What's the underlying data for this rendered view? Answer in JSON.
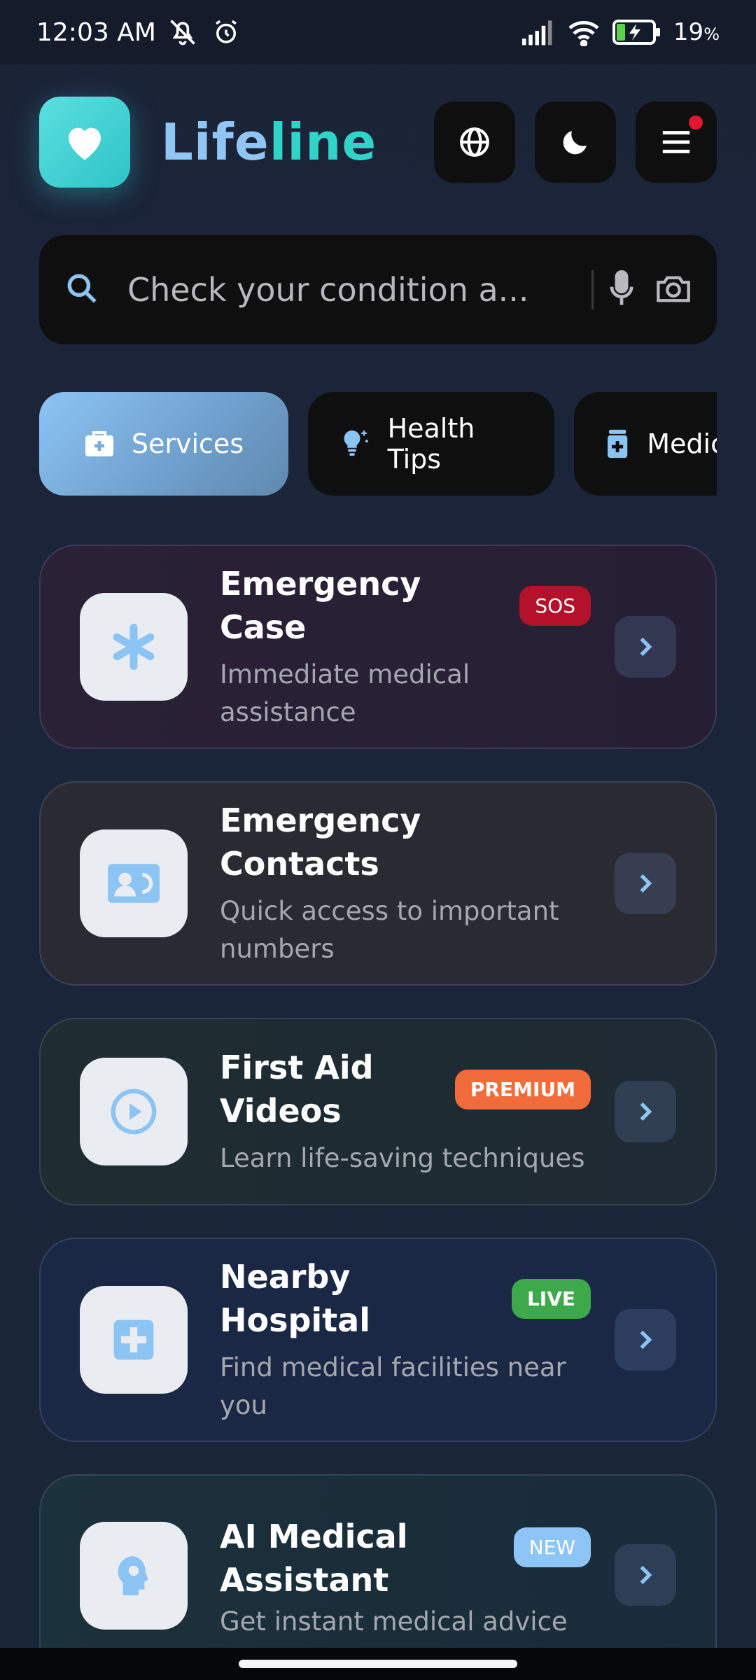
{
  "status_bar": {
    "time": "12:03 AM",
    "battery": "19",
    "battery_unit": "%",
    "icons": [
      "mute-icon",
      "alarm-icon",
      "signal-icon",
      "wifi-icon",
      "battery-charging-icon"
    ]
  },
  "header": {
    "title_part1": "Life",
    "title_part2": "line",
    "logo_icon": "heart-icon",
    "buttons": [
      "globe-icon",
      "moon-icon",
      "menu-icon"
    ],
    "colors": {
      "title_part1": "#90c6f5",
      "title_part2": "#2fd3c8",
      "notification_dot": "#e0182e"
    }
  },
  "search": {
    "placeholder": "Check your condition a...",
    "icons": [
      "search-icon",
      "microphone-icon",
      "camera-icon"
    ]
  },
  "tabs": [
    {
      "label": "Services",
      "icon": "medical-kit-icon",
      "active": true
    },
    {
      "label": "Health Tips",
      "icon": "lightbulb-icon",
      "active": false
    },
    {
      "label": "Medic",
      "icon": "medicine-bottle-icon",
      "active": false
    }
  ],
  "cards": [
    {
      "title": "Emergency Case",
      "subtitle": "Immediate medical assistance",
      "badge": "SOS",
      "badge_color": "#b3122a",
      "icon": "asterisk-icon"
    },
    {
      "title": "Emergency Contacts",
      "subtitle": "Quick access to important numbers",
      "badge": "",
      "icon": "contact-card-icon"
    },
    {
      "title": "First Aid Videos",
      "subtitle": "Learn life-saving techniques",
      "badge": "PREMIUM",
      "badge_color": "#f26b3a",
      "icon": "play-circle-icon"
    },
    {
      "title": "Nearby Hospital",
      "subtitle": "Find medical facilities near you",
      "badge": "LIVE",
      "badge_color": "#3ea94a",
      "icon": "hospital-cross-icon"
    },
    {
      "title": "AI Medical Assistant",
      "subtitle": "Get instant medical advice",
      "badge": "NEW",
      "badge_color": "#8ec5f7",
      "icon": "ai-head-icon"
    }
  ]
}
